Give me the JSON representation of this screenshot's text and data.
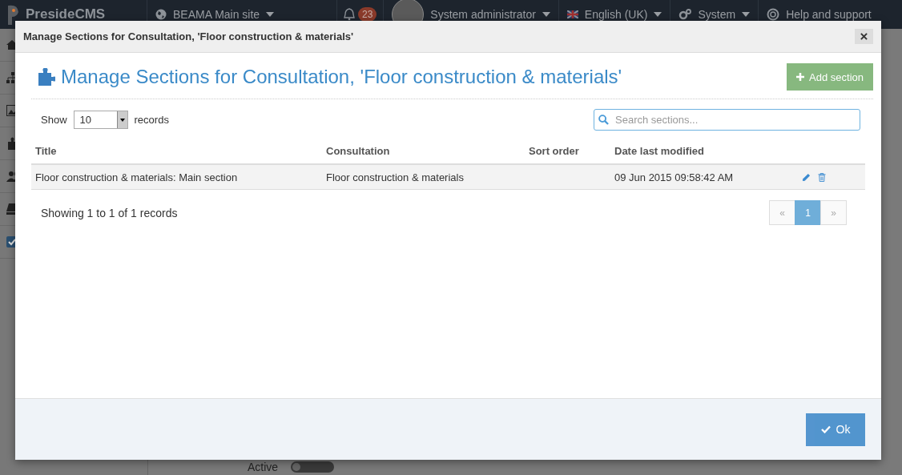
{
  "navbar": {
    "logo": "PresideCMS",
    "site": "BEAMA Main site",
    "notifications": "23",
    "user": "System administrator",
    "language": "English (UK)",
    "system": "System",
    "help": "Help and support"
  },
  "background": {
    "toggle_label": "Active",
    "toggle_on": false
  },
  "modal": {
    "title": "Manage Sections for Consultation, 'Floor construction & materials'",
    "heading": "Manage Sections for Consultation, 'Floor construction & materials'",
    "add_button": "Add section",
    "show_label": "Show",
    "page_size": "10",
    "records_label": "records",
    "search": {
      "placeholder": "Search sections..."
    },
    "table": {
      "columns": [
        "Title",
        "Consultation",
        "Sort order",
        "Date last modified"
      ],
      "rows": [
        {
          "title": "Floor construction & materials: Main section",
          "consultation": "Floor construction & materials",
          "date_last_modified": "09 Jun 2015 09:58:42 AM"
        }
      ]
    },
    "info": "Showing 1 to 1 of 1 records",
    "pagination": [
      {
        "label": "«",
        "selected": false,
        "disabled": true
      },
      {
        "label": "1",
        "selected": true,
        "disabled": false
      },
      {
        "label": "»",
        "selected": false,
        "disabled": true
      }
    ],
    "ok_button": "Ok"
  }
}
